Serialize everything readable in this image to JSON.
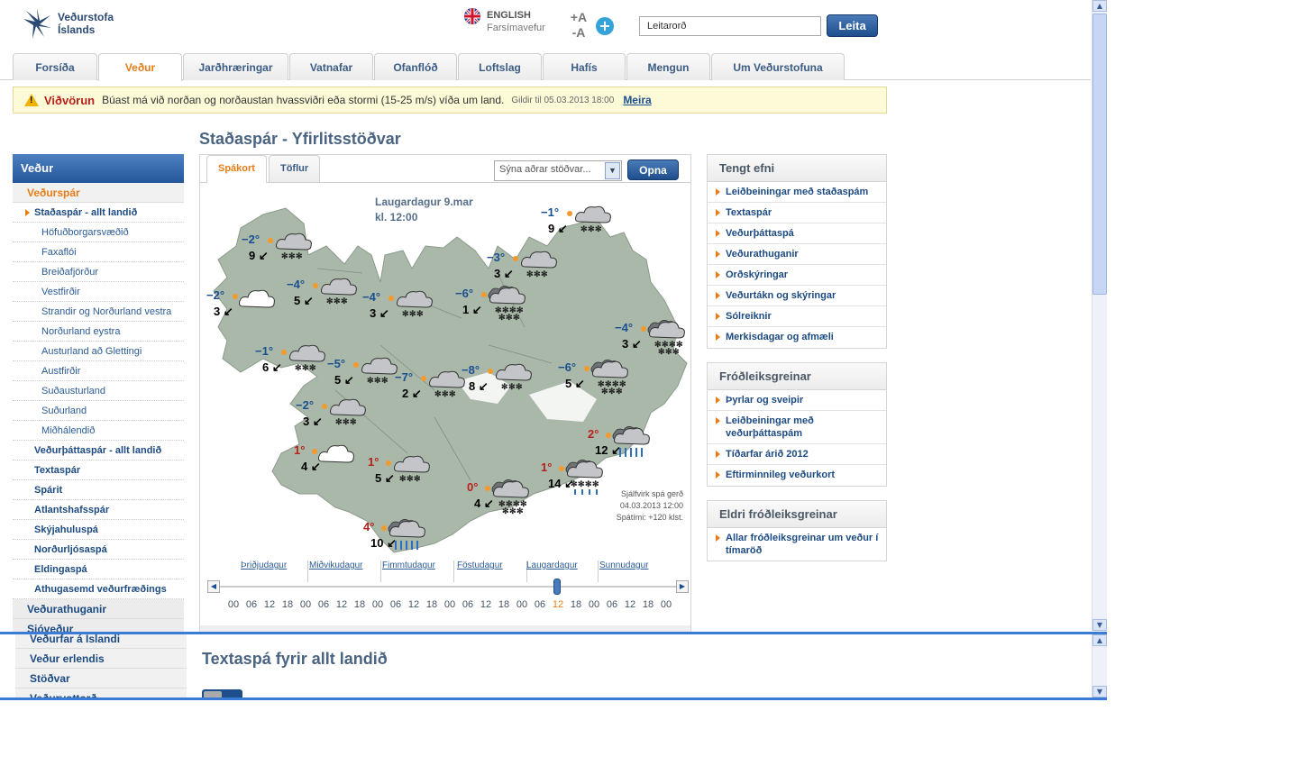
{
  "header": {
    "logo_line1": "Veðurstofa",
    "logo_line2": "Íslands",
    "lang_label": "ENGLISH",
    "mobile_label": "Farsímavefur",
    "font_increase": "+A",
    "font_decrease": "-A",
    "search_placeholder": "Leitarorð",
    "search_button": "Leita"
  },
  "nav": {
    "tabs": [
      {
        "label": "Forsíða"
      },
      {
        "label": "Veður"
      },
      {
        "label": "Jarðhræringar"
      },
      {
        "label": "Vatnafar"
      },
      {
        "label": "Ofanflóð"
      },
      {
        "label": "Loftslag"
      },
      {
        "label": "Hafís"
      },
      {
        "label": "Mengun"
      },
      {
        "label": "Um Veðurstofuna"
      }
    ],
    "active": "Veður"
  },
  "warning": {
    "title": "Viðvörun",
    "message": "Búast má við norðan og norðaustan hvassviðri eða stormi (15-25 m/s) víða um land.",
    "valid": "Gildir til 05.03.2013 18:00",
    "more": "Meira"
  },
  "left_menu": {
    "heading": "Veður",
    "section": "Veðurspár",
    "current": "Staðaspár - allt landið",
    "subitems": [
      "Höfuðborgarsvæðið",
      "Faxaflói",
      "Breiðafjörður",
      "Vestfirðir",
      "Strandir og Norðurland vestra",
      "Norðurland eystra",
      "Austurland að Glettingi",
      "Austfirðir",
      "Suðausturland",
      "Suðurland",
      "Miðhálendið"
    ],
    "items": [
      "Veðurþáttaspár - allt landið",
      "Textaspár",
      "Spárit",
      "Atlantshafsspár",
      "Skýjahuluspá",
      "Norðurljósaspá",
      "Eldingaspá",
      "Athugasemd veðurfræðings"
    ],
    "section2": "Veðurathuganir"
  },
  "page_title": "Staðaspár - Yfirlitsstöðvar",
  "forecast": {
    "tabs": [
      "Spákort",
      "Töflur"
    ],
    "active_tab": "Spákort",
    "select_value": "Sýna aðrar stöðvar...",
    "open_button": "Opna",
    "day_line1": "Laugardagur 9.mar",
    "day_line2": "kl. 12:00",
    "note_line1": "Sjálfvirk spá gerð",
    "note_line2": "04.03.2013 12:00",
    "note_line3": "Spátími: +120 klst.",
    "stations": [
      {
        "temp": "−2°",
        "wind": "9",
        "icon": "snow-cloud"
      },
      {
        "temp": "−1°",
        "wind": "9",
        "icon": "snow-cloud"
      },
      {
        "temp": "−3°",
        "wind": "3",
        "icon": "snow-cloud"
      },
      {
        "temp": "−2°",
        "wind": "3",
        "icon": "cloudy"
      },
      {
        "temp": "−4°",
        "wind": "5",
        "icon": "snow-cloud"
      },
      {
        "temp": "−4°",
        "wind": "3",
        "icon": "snow-cloud"
      },
      {
        "temp": "−6°",
        "wind": "1",
        "icon": "heavy-snow-cloud"
      },
      {
        "temp": "−4°",
        "wind": "3",
        "icon": "heavy-snow-cloud"
      },
      {
        "temp": "−1°",
        "wind": "6",
        "icon": "snow-cloud"
      },
      {
        "temp": "−5°",
        "wind": "5",
        "icon": "snow-cloud"
      },
      {
        "temp": "−7°",
        "wind": "2",
        "icon": "snow-cloud"
      },
      {
        "temp": "−8°",
        "wind": "8",
        "icon": "snow-cloud"
      },
      {
        "temp": "−6°",
        "wind": "5",
        "icon": "heavy-snow-cloud"
      },
      {
        "temp": "−2°",
        "wind": "3",
        "icon": "snow-cloud"
      },
      {
        "temp": "2°",
        "wind": "12",
        "icon": "rain-cloud"
      },
      {
        "temp": "1°",
        "wind": "4",
        "icon": "cloudy"
      },
      {
        "temp": "1°",
        "wind": "5",
        "icon": "snow-cloud"
      },
      {
        "temp": "1°",
        "wind": "14",
        "icon": "sleet-cloud"
      },
      {
        "temp": "0°",
        "wind": "4",
        "icon": "heavy-snow-cloud"
      },
      {
        "temp": "4°",
        "wind": "10",
        "icon": "rain-cloud"
      }
    ],
    "days": [
      "Þriðjudagur",
      "Miðvikudagur",
      "Fimmtudagur",
      "Föstudagur",
      "Laugardagur",
      "Sunnudagur"
    ],
    "hours": [
      "00",
      "06",
      "12",
      "18",
      "00",
      "06",
      "12",
      "18",
      "00",
      "06",
      "12",
      "18",
      "00",
      "06",
      "12",
      "18",
      "00",
      "06",
      "12",
      "18",
      "00",
      "06",
      "12",
      "18",
      "00"
    ],
    "selected_hour_index": 18,
    "slider_position": 0.74
  },
  "related": {
    "heading": "Tengt efni",
    "items": [
      "Leiðbeiningar með staðaspám",
      "Textaspár",
      "Veðurþáttaspá",
      "Veðurathuganir",
      "Orðskýringar",
      "Veðurtákn og skýringar",
      "Sólreiknir",
      "Merkisdagar og afmæli"
    ]
  },
  "articles": {
    "heading": "Fróðleiksgreinar",
    "items": [
      "Þyrlar og sveipir",
      "Leiðbeiningar með veðurþáttaspám",
      "Tíðarfar árið 2012",
      "Eftirminnileg veðurkort"
    ]
  },
  "older_articles": {
    "heading": "Eldri fróðleiksgreinar",
    "items": [
      "Allar fróðleiksgreinar um veður í tímaröð"
    ]
  },
  "lower_frame": {
    "menu": [
      "Veðurfar á Íslandi",
      "Veður erlendis",
      "Stöðvar",
      "Veðurvottorð"
    ],
    "title": "Textaspá fyrir allt landið"
  },
  "overlap_label": "Sjóveður",
  "colors": {
    "accent": "#e87d18",
    "brand_blue": "#1e4f8c",
    "warning_red": "#b8201a"
  }
}
